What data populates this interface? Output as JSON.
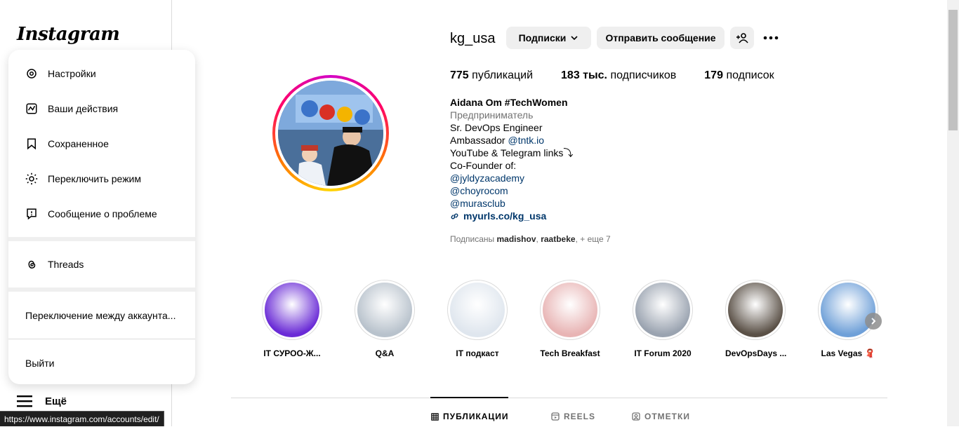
{
  "sidebar": {
    "logo": "Instagram",
    "more_label": "Ещё"
  },
  "menu": {
    "items": [
      {
        "label": "Настройки",
        "icon": "gear-icon"
      },
      {
        "label": "Ваши действия",
        "icon": "activity-icon"
      },
      {
        "label": "Сохраненное",
        "icon": "bookmark-icon"
      },
      {
        "label": "Переключить режим",
        "icon": "sun-icon"
      },
      {
        "label": "Сообщение о проблеме",
        "icon": "report-icon"
      }
    ],
    "threads_label": "Threads",
    "switch_label": "Переключение между аккаунта...",
    "logout_label": "Выйти"
  },
  "status_bar": "https://www.instagram.com/accounts/edit/",
  "profile": {
    "username": "kg_usa",
    "following_button": "Подписки",
    "message_button": "Отправить сообщение",
    "stats": {
      "posts_value": "775",
      "posts_label": "публикаций",
      "followers_value": "183 тыс.",
      "followers_label": "подписчиков",
      "following_value": "179",
      "following_label": "подписок"
    },
    "bio": {
      "name": "Aidana Om #TechWomen",
      "category": "Предприниматель",
      "line1": "Sr. DevOps Engineer",
      "line2_prefix": "Ambassador ",
      "line2_link": "@tntk.io",
      "line3": "YouTube & Telegram links⤵",
      "line4": "Co-Founder of:",
      "link1": "@jyldyzacademy",
      "link2": "@choyrocom",
      "link3": "@murasclub",
      "url": "myurls.co/kg_usa"
    },
    "followed_by": {
      "prefix": "Подписаны ",
      "user1": "madishov",
      "sep": ", ",
      "user2": "raatbeke",
      "suffix": ", + еще 7"
    }
  },
  "highlights": [
    {
      "label": "IT СУРОО-Ж...",
      "color": "#6a2bd6"
    },
    {
      "label": "Q&A",
      "color": "#b8c2cc"
    },
    {
      "label": "IT подкаст",
      "color": "#dfe6ee"
    },
    {
      "label": "Tech Breakfast",
      "color": "#e8b4b4"
    },
    {
      "label": "IT Forum 2020",
      "color": "#9aa3b0"
    },
    {
      "label": "DevOpsDays ...",
      "color": "#5a5046"
    },
    {
      "label": "Las Vegas 🧣",
      "color": "#6fa0d8"
    }
  ],
  "tabs": {
    "posts": "ПУБЛИКАЦИИ",
    "reels": "REELS",
    "tagged": "ОТМЕТКИ"
  }
}
